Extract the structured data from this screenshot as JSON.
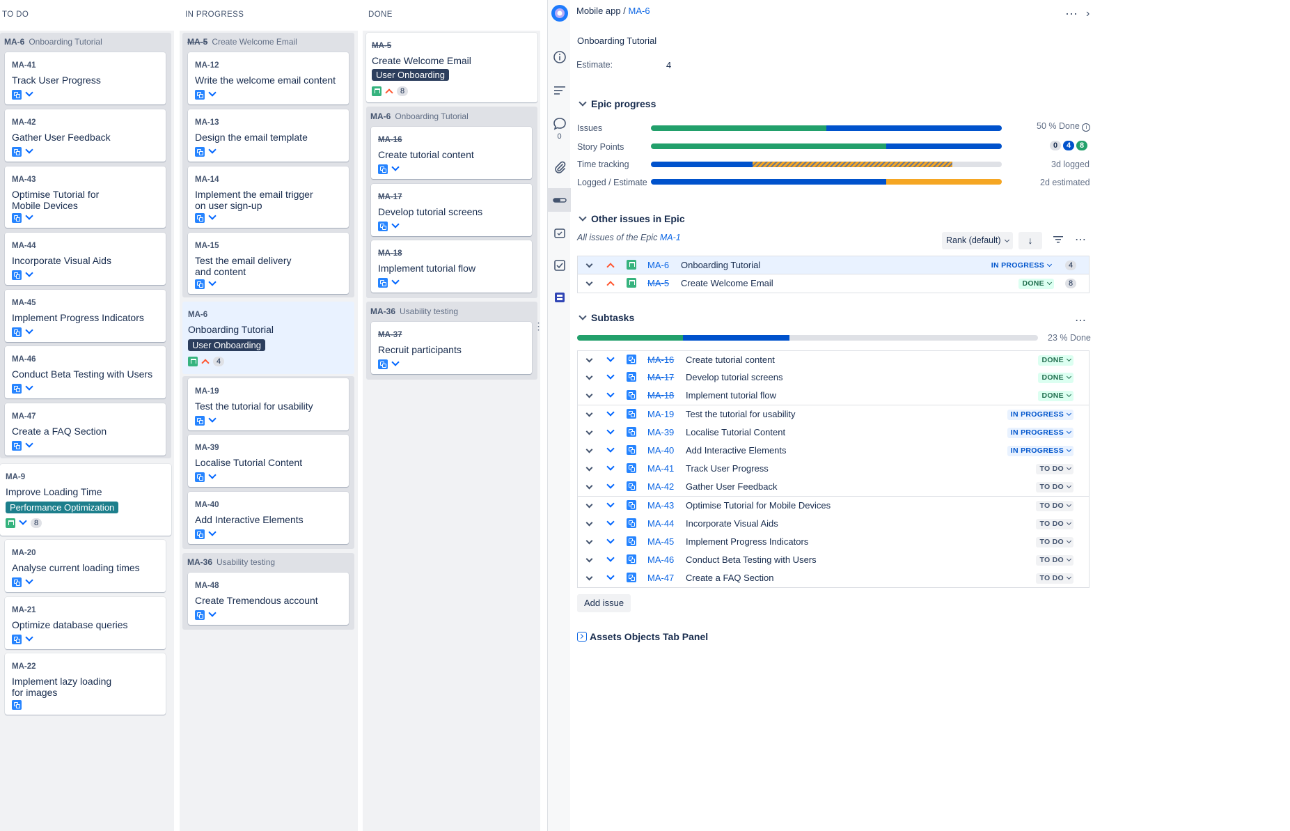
{
  "board": {
    "columns": [
      "TO DO",
      "IN PROGRESS",
      "DONE"
    ],
    "todo": {
      "group1": {
        "key": "MA-6",
        "title": "Onboarding Tutorial"
      },
      "cards": [
        {
          "key": "MA-41",
          "title": "Track User Progress"
        },
        {
          "key": "MA-42",
          "title": "Gather User Feedback"
        },
        {
          "key": "MA-43",
          "title": "Optimise Tutorial for Mobile Devices"
        },
        {
          "key": "MA-44",
          "title": "Incorporate Visual Aids"
        },
        {
          "key": "MA-45",
          "title": "Implement Progress Indicators"
        },
        {
          "key": "MA-46",
          "title": "Conduct Beta Testing with Users"
        },
        {
          "key": "MA-47",
          "title": "Create a FAQ Section"
        }
      ],
      "parent": {
        "key": "MA-9",
        "title": "Improve Loading Time",
        "label": "Performance Optimization",
        "points": "8"
      },
      "cards2": [
        {
          "key": "MA-20",
          "title": "Analyse current loading times"
        },
        {
          "key": "MA-21",
          "title": "Optimize database queries"
        },
        {
          "key": "MA-22",
          "title": "Implement lazy loading for images"
        }
      ]
    },
    "inprogress": {
      "group1": {
        "key": "MA-5",
        "title": "Create Welcome Email"
      },
      "cards": [
        {
          "key": "MA-12",
          "title": "Write the welcome email content"
        },
        {
          "key": "MA-13",
          "title": "Design the email template"
        },
        {
          "key": "MA-14",
          "title": "Implement the email trigger on user sign-up"
        },
        {
          "key": "MA-15",
          "title": "Test the email delivery and content"
        }
      ],
      "parent": {
        "key": "MA-6",
        "title": "Onboarding Tutorial",
        "label": "User Onboarding",
        "points": "4"
      },
      "cards2": [
        {
          "key": "MA-19",
          "title": "Test the tutorial for usability"
        },
        {
          "key": "MA-39",
          "title": "Localise Tutorial Content"
        },
        {
          "key": "MA-40",
          "title": "Add Interactive Elements"
        }
      ],
      "group2": {
        "key": "MA-36",
        "title": "Usability testing"
      },
      "cards3": [
        {
          "key": "MA-48",
          "title": "Create Tremendous account"
        }
      ]
    },
    "done": {
      "parent": {
        "key": "MA-5",
        "title": "Create Welcome Email",
        "label": "User Onboarding",
        "points": "8"
      },
      "group1": {
        "key": "MA-6",
        "title": "Onboarding Tutorial"
      },
      "cards": [
        {
          "key": "MA-16",
          "title": "Create tutorial content"
        },
        {
          "key": "MA-17",
          "title": "Develop tutorial screens"
        },
        {
          "key": "MA-18",
          "title": "Implement tutorial flow"
        }
      ],
      "group2": {
        "key": "MA-36",
        "title": "Usability testing"
      },
      "cards2": [
        {
          "key": "MA-37",
          "title": "Recruit participants"
        }
      ]
    }
  },
  "rail": {
    "comments_count": "0"
  },
  "detail": {
    "breadcrumb_project": "Mobile app",
    "breadcrumb_sep": "/",
    "breadcrumb_key": "MA-6",
    "title": "Onboarding Tutorial",
    "estimate_label": "Estimate:",
    "estimate_value": "4",
    "epic_progress": {
      "heading": "Epic progress",
      "issues_label": "Issues",
      "issues_done_pct": 50,
      "issues_text": "50 % Done",
      "story_points_label": "Story Points",
      "sp_done_fraction": 0.67,
      "sp_counts": [
        "0",
        "4",
        "8"
      ],
      "time_tracking_label": "Time tracking",
      "time_logged_fraction": 0.29,
      "time_tracking_text": "3d logged",
      "logged_estimate_label": "Logged / Estimate",
      "logged_fraction": 0.67,
      "logged_estimate_text": "2d estimated"
    },
    "other_issues": {
      "heading": "Other issues in Epic",
      "subtitle_prefix": "All issues of the Epic",
      "subtitle_key": "MA-1",
      "rank_label": "Rank (default)",
      "rows": [
        {
          "key": "MA-6",
          "summary": "Onboarding Tutorial",
          "status": "IN PROGRESS",
          "points": "4"
        },
        {
          "key": "MA-5",
          "summary": "Create Welcome Email",
          "status": "DONE",
          "points": "8"
        }
      ]
    },
    "subtasks": {
      "heading": "Subtasks",
      "done_text": "23 % Done",
      "done_fraction": 0.23,
      "inprogress_fraction": 0.23,
      "rows": [
        {
          "key": "MA-16",
          "summary": "Create tutorial content",
          "status": "DONE"
        },
        {
          "key": "MA-17",
          "summary": "Develop tutorial screens",
          "status": "DONE"
        },
        {
          "key": "MA-18",
          "summary": "Implement tutorial flow",
          "status": "DONE"
        },
        {
          "key": "MA-19",
          "summary": "Test the tutorial for usability",
          "status": "IN PROGRESS"
        },
        {
          "key": "MA-39",
          "summary": "Localise Tutorial Content",
          "status": "IN PROGRESS"
        },
        {
          "key": "MA-40",
          "summary": "Add Interactive Elements",
          "status": "IN PROGRESS"
        },
        {
          "key": "MA-41",
          "summary": "Track User Progress",
          "status": "TO DO"
        },
        {
          "key": "MA-42",
          "summary": "Gather User Feedback",
          "status": "TO DO"
        },
        {
          "key": "MA-43",
          "summary": "Optimise Tutorial for Mobile Devices",
          "status": "TO DO"
        },
        {
          "key": "MA-44",
          "summary": "Incorporate Visual Aids",
          "status": "TO DO"
        },
        {
          "key": "MA-45",
          "summary": "Implement Progress Indicators",
          "status": "TO DO"
        },
        {
          "key": "MA-46",
          "summary": "Conduct Beta Testing with Users",
          "status": "TO DO"
        },
        {
          "key": "MA-47",
          "summary": "Create a FAQ Section",
          "status": "TO DO"
        }
      ],
      "add_issue_label": "Add issue"
    },
    "assets_heading": "Assets Objects Tab Panel"
  },
  "colors": {
    "green": "#1f845a",
    "blue": "#0052cc",
    "orange": "#f5a623",
    "label_dark": "#2c3e5d",
    "label_teal": "#1d7f8c"
  }
}
